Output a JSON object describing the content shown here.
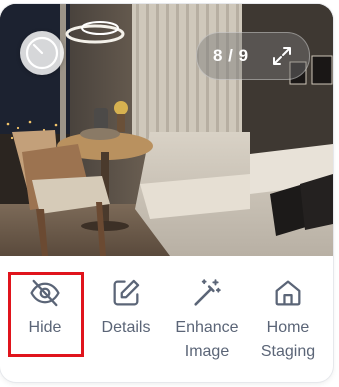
{
  "photo": {
    "counter": "8 / 9",
    "alt_subject": "living-room-photo"
  },
  "actions": [
    {
      "label": "Hide",
      "icon": "eye-off-icon"
    },
    {
      "label": "Details",
      "icon": "pencil-square-icon"
    },
    {
      "label": "Enhance Image",
      "line1": "Enhance",
      "line2": "Image",
      "icon": "magic-wand-icon"
    },
    {
      "label": "Home Staging",
      "line1": "Home",
      "line2": "Staging",
      "icon": "home-icon"
    }
  ],
  "colors": {
    "icon_text": "#5b6577",
    "highlight": "#e0141c"
  }
}
